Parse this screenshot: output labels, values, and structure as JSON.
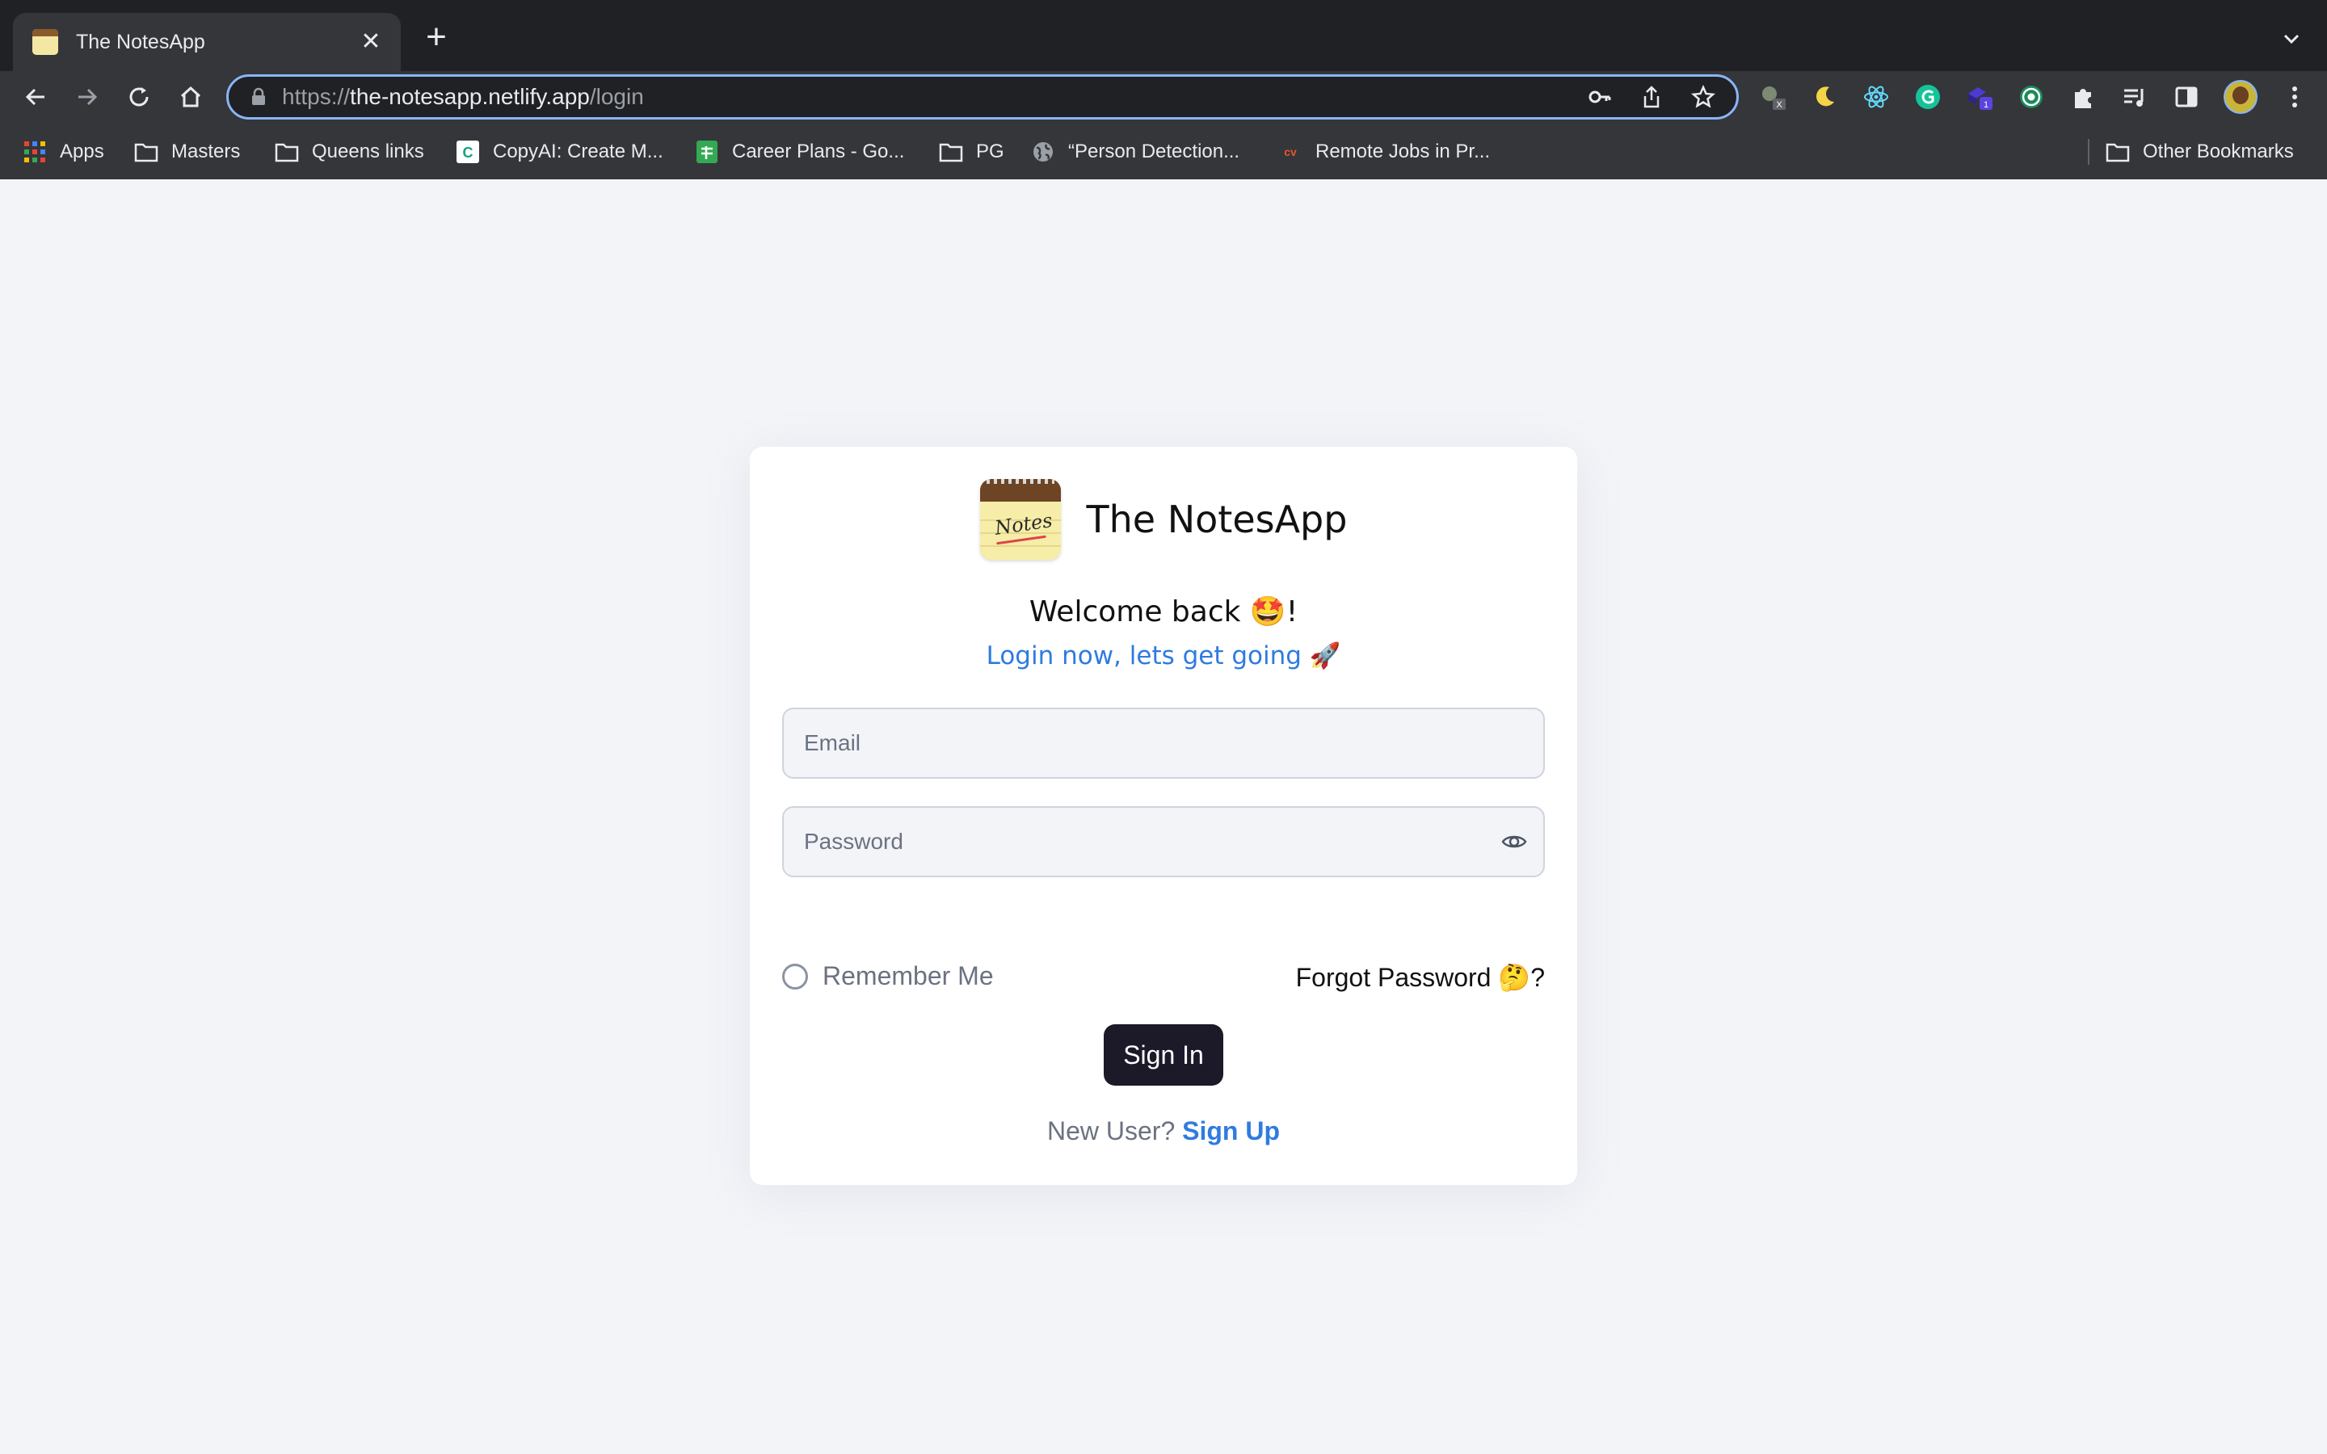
{
  "browser": {
    "tab_title": "The NotesApp",
    "tab_close": "✕",
    "new_tab": "+",
    "url_scheme": "https://",
    "url_host": "the-notesapp.netlify.app",
    "url_path": "/login",
    "accent_color": "#8ab4f8",
    "extension_badges": {
      "badge_x": "X",
      "badge_1": "1"
    },
    "bookmarks": [
      {
        "label": "Apps",
        "icon": "apps-grid-icon"
      },
      {
        "label": "Masters",
        "icon": "folder-icon"
      },
      {
        "label": "Queens links",
        "icon": "folder-icon"
      },
      {
        "label": "CopyAI: Create M...",
        "icon": "copyai-icon"
      },
      {
        "label": "Career Plans - Go...",
        "icon": "sheets-icon"
      },
      {
        "label": "PG",
        "icon": "folder-icon"
      },
      {
        "label": "“Person Detection...",
        "icon": "globe-icon"
      },
      {
        "label": "Remote Jobs in Pr...",
        "icon": "cv-icon"
      }
    ],
    "other_bookmarks": "Other Bookmarks"
  },
  "login": {
    "app_name": "The NotesApp",
    "logo_text": "Notes",
    "welcome": "Welcome back 🤩!",
    "subtitle": "Login now, lets get going 🚀",
    "email_placeholder": "Email",
    "password_placeholder": "Password",
    "remember_me": "Remember Me",
    "forgot_password": "Forgot Password 🤔?",
    "sign_in": "Sign In",
    "new_user": "New User?",
    "sign_up": "Sign Up",
    "accent_color": "#2f7be0",
    "button_color": "#1c1a29"
  }
}
